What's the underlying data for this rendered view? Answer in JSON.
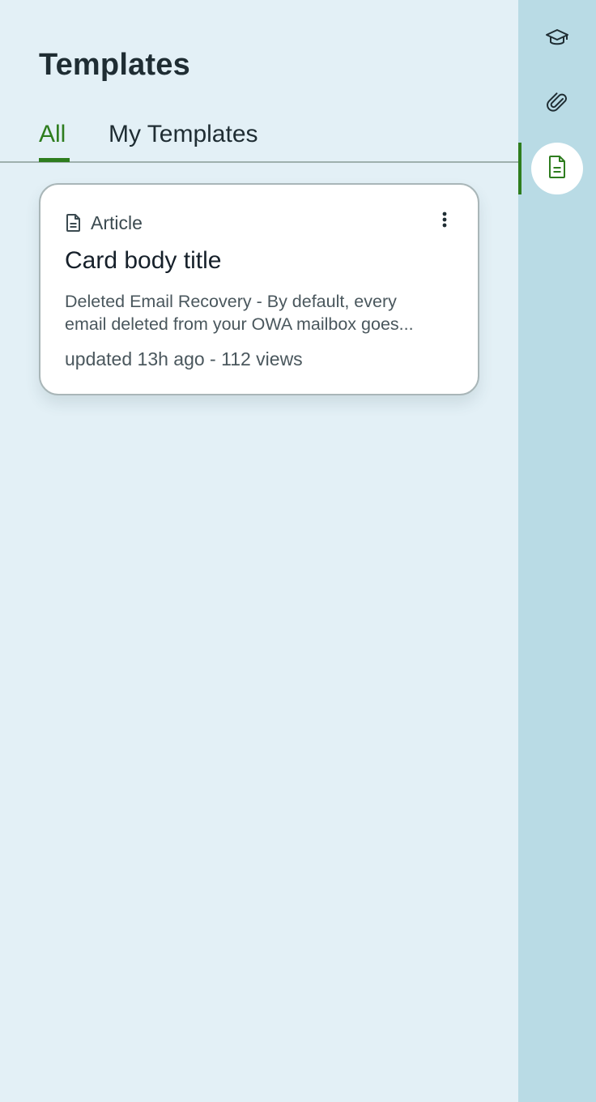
{
  "page": {
    "title": "Templates"
  },
  "tabs": [
    {
      "label": "All",
      "active": true
    },
    {
      "label": "My Templates",
      "active": false
    }
  ],
  "cards": [
    {
      "type_label": "Article",
      "type_icon": "document-icon",
      "title": "Card body title",
      "description_line1": "Deleted Email Recovery - By default, every",
      "description_line2": "email deleted from your OWA mailbox goes...",
      "meta": "updated 13h ago - 112 views",
      "menu_icon": "more-vertical-icon"
    }
  ],
  "sidebar": {
    "items": [
      {
        "icon": "graduation-cap-icon",
        "active": false
      },
      {
        "icon": "paperclip-icon",
        "active": false
      },
      {
        "icon": "document-icon",
        "active": true
      }
    ]
  },
  "colors": {
    "accent": "#2e7d1e",
    "main_bg": "#e3f0f6",
    "sidebar_bg": "#b9dbe5",
    "card_bg": "#ffffff",
    "text_primary": "#1f2d33"
  }
}
